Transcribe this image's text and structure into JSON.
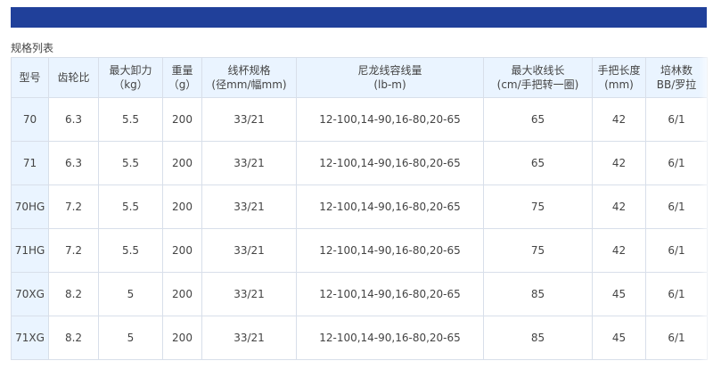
{
  "section_title": "规格列表",
  "table": {
    "headers": [
      [
        "型号"
      ],
      [
        "齿轮比"
      ],
      [
        "最大卸力",
        "（kg）"
      ],
      [
        "重量",
        "（g）"
      ],
      [
        "线杯规格",
        "(径mm/幅mm)"
      ],
      [
        "尼龙线容线量",
        "(lb-m)"
      ],
      [
        "最大收线长",
        "(cm/手把转一圈)"
      ],
      [
        "手把长度",
        "(mm)"
      ],
      [
        "培林数",
        "BB/罗拉"
      ]
    ],
    "rows": [
      [
        "70",
        "6.3",
        "5.5",
        "200",
        "33/21",
        "12-100,14-90,16-80,20-65",
        "65",
        "42",
        "6/1"
      ],
      [
        "71",
        "6.3",
        "5.5",
        "200",
        "33/21",
        "12-100,14-90,16-80,20-65",
        "65",
        "42",
        "6/1"
      ],
      [
        "70HG",
        "7.2",
        "5.5",
        "200",
        "33/21",
        "12-100,14-90,16-80,20-65",
        "75",
        "42",
        "6/1"
      ],
      [
        "71HG",
        "7.2",
        "5.5",
        "200",
        "33/21",
        "12-100,14-90,16-80,20-65",
        "75",
        "42",
        "6/1"
      ],
      [
        "70XG",
        "8.2",
        "5",
        "200",
        "33/21",
        "12-100,14-90,16-80,20-65",
        "85",
        "45",
        "6/1"
      ],
      [
        "71XG",
        "8.2",
        "5",
        "200",
        "33/21",
        "12-100,14-90,16-80,20-65",
        "85",
        "45",
        "6/1"
      ]
    ]
  },
  "colors": {
    "top_bar": "#20409a",
    "header_bg": "#eaf4ff",
    "border": "#d8dfea"
  }
}
